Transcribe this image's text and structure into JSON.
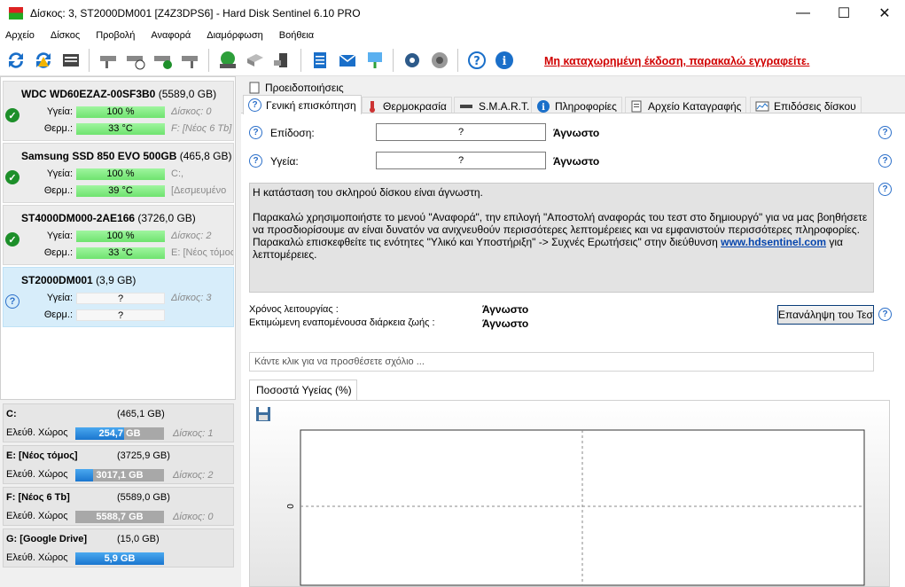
{
  "window": {
    "title": "Δίσκος: 3, ST2000DM001 [Z4Z3DPS6]  -  Hard Disk Sentinel 6.10 PRO"
  },
  "menu": [
    "Αρχείο",
    "Δίσκος",
    "Προβολή",
    "Αναφορά",
    "Διαμόρφωση",
    "Βοήθεια"
  ],
  "toolbar": {
    "unregistered": "Μη καταχωρημένη έκδοση, παρακαλώ εγγραφείτε."
  },
  "disks": [
    {
      "name": "WDC WD60EZAZ-00SF3B0",
      "size": "(5589,0 GB)",
      "health_label": "Υγεία:",
      "health": "100 %",
      "temp_label": "Θερμ.:",
      "temp": "33 °C",
      "side1": "Δίσκος: 0",
      "side2": "F: [Νέος 6 Tb]",
      "status": "ok"
    },
    {
      "name": "Samsung SSD 850 EVO 500GB",
      "size": "(465,8 GB)",
      "health_label": "Υγεία:",
      "health": "100 %",
      "temp_label": "Θερμ.:",
      "temp": "39 °C",
      "side1": "C:,",
      "side2": "[Δεσμευμένο",
      "status": "ok"
    },
    {
      "name": "ST4000DM000-2AE166",
      "size": "(3726,0 GB)",
      "health_label": "Υγεία:",
      "health": "100 %",
      "temp_label": "Θερμ.:",
      "temp": "33 °C",
      "side1": "Δίσκος: 2",
      "side2": "E: [Νέος τόμος",
      "status": "ok"
    },
    {
      "name": "ST2000DM001",
      "size": "(3,9 GB)",
      "health_label": "Υγεία:",
      "health": "?",
      "temp_label": "Θερμ.:",
      "temp": "?",
      "side1": "Δίσκος: 3",
      "side2": "",
      "status": "unknown"
    }
  ],
  "volumes": [
    {
      "name": "C:",
      "size": "(465,1 GB)",
      "free_label": "Ελεύθ. Χώρος",
      "free": "254,7 GB",
      "free_pct": 55,
      "disk": "Δίσκος: 1"
    },
    {
      "name": "E: [Νέος τόμος]",
      "size": "(3725,9 GB)",
      "free_label": "Ελεύθ. Χώρος",
      "free": "3017,1 GB",
      "free_pct": 20,
      "disk": "Δίσκος: 2"
    },
    {
      "name": "F: [Νέος 6 Tb]",
      "size": "(5589,0 GB)",
      "free_label": "Ελεύθ. Χώρος",
      "free": "5588,7 GB",
      "free_pct": 0,
      "disk": "Δίσκος: 0"
    },
    {
      "name": "G: [Google Drive]",
      "size": "(15,0 GB)",
      "free_label": "Ελεύθ. Χώρος",
      "free": "5,9 GB",
      "free_pct": 100,
      "disk": ""
    }
  ],
  "tabs": {
    "top": "Προειδοποιήσεις",
    "row": [
      "Γενική επισκόπηση",
      "Θερμοκρασία",
      "S.M.A.R.T.",
      "Πληροφορίες",
      "Αρχείο Καταγραφής",
      "Επιδόσεις δίσκου"
    ]
  },
  "overview": {
    "performance_label": "Επίδοση:",
    "performance_value": "?",
    "performance_text": "Άγνωστο",
    "health_label": "Υγεία:",
    "health_value": "?",
    "health_text": "Άγνωστο",
    "msg1": "Η κατάσταση του σκληρού δίσκου είναι άγνωστη.",
    "msg2": "Παρακαλώ χρησιμοποιήστε το μενού \"Αναφορά\", την επιλογή \"Αποστολή αναφοράς του τεστ στο δημιουργό\" για να μας βοηθήσετε να προσδιορίσουμε αν είναι δυνατόν να ανιχνευθούν περισσότερες λεπτομέρειες και να εμφανιστούν περισσότερες πληροφορίες.",
    "msg3a": "Παρακαλώ επισκεφθείτε τις ενότητες \"Υλικό και Υποστήριξη\" -> Συχνές Ερωτήσεις\" στην διεύθυνση ",
    "msg3link": "www.hdsentinel.com",
    "msg3b": " για λεπτομέρειες.",
    "uptime_label": "Χρόνος λειτουργίας :",
    "uptime_value": "Άγνωστο",
    "lifetime_label": "Εκτιμώμενη εναπομένουσα διάρκεια ζωής :",
    "lifetime_value": "Άγνωστο",
    "retest_button": "Επανάληψη του Τεστ",
    "comment_placeholder": "Κάντε κλικ για να προσθέσετε σχόλιο ..."
  },
  "chart_data": {
    "type": "line",
    "tab": "Ποσοστά Υγείας (%)",
    "ytick": "0",
    "series": []
  }
}
